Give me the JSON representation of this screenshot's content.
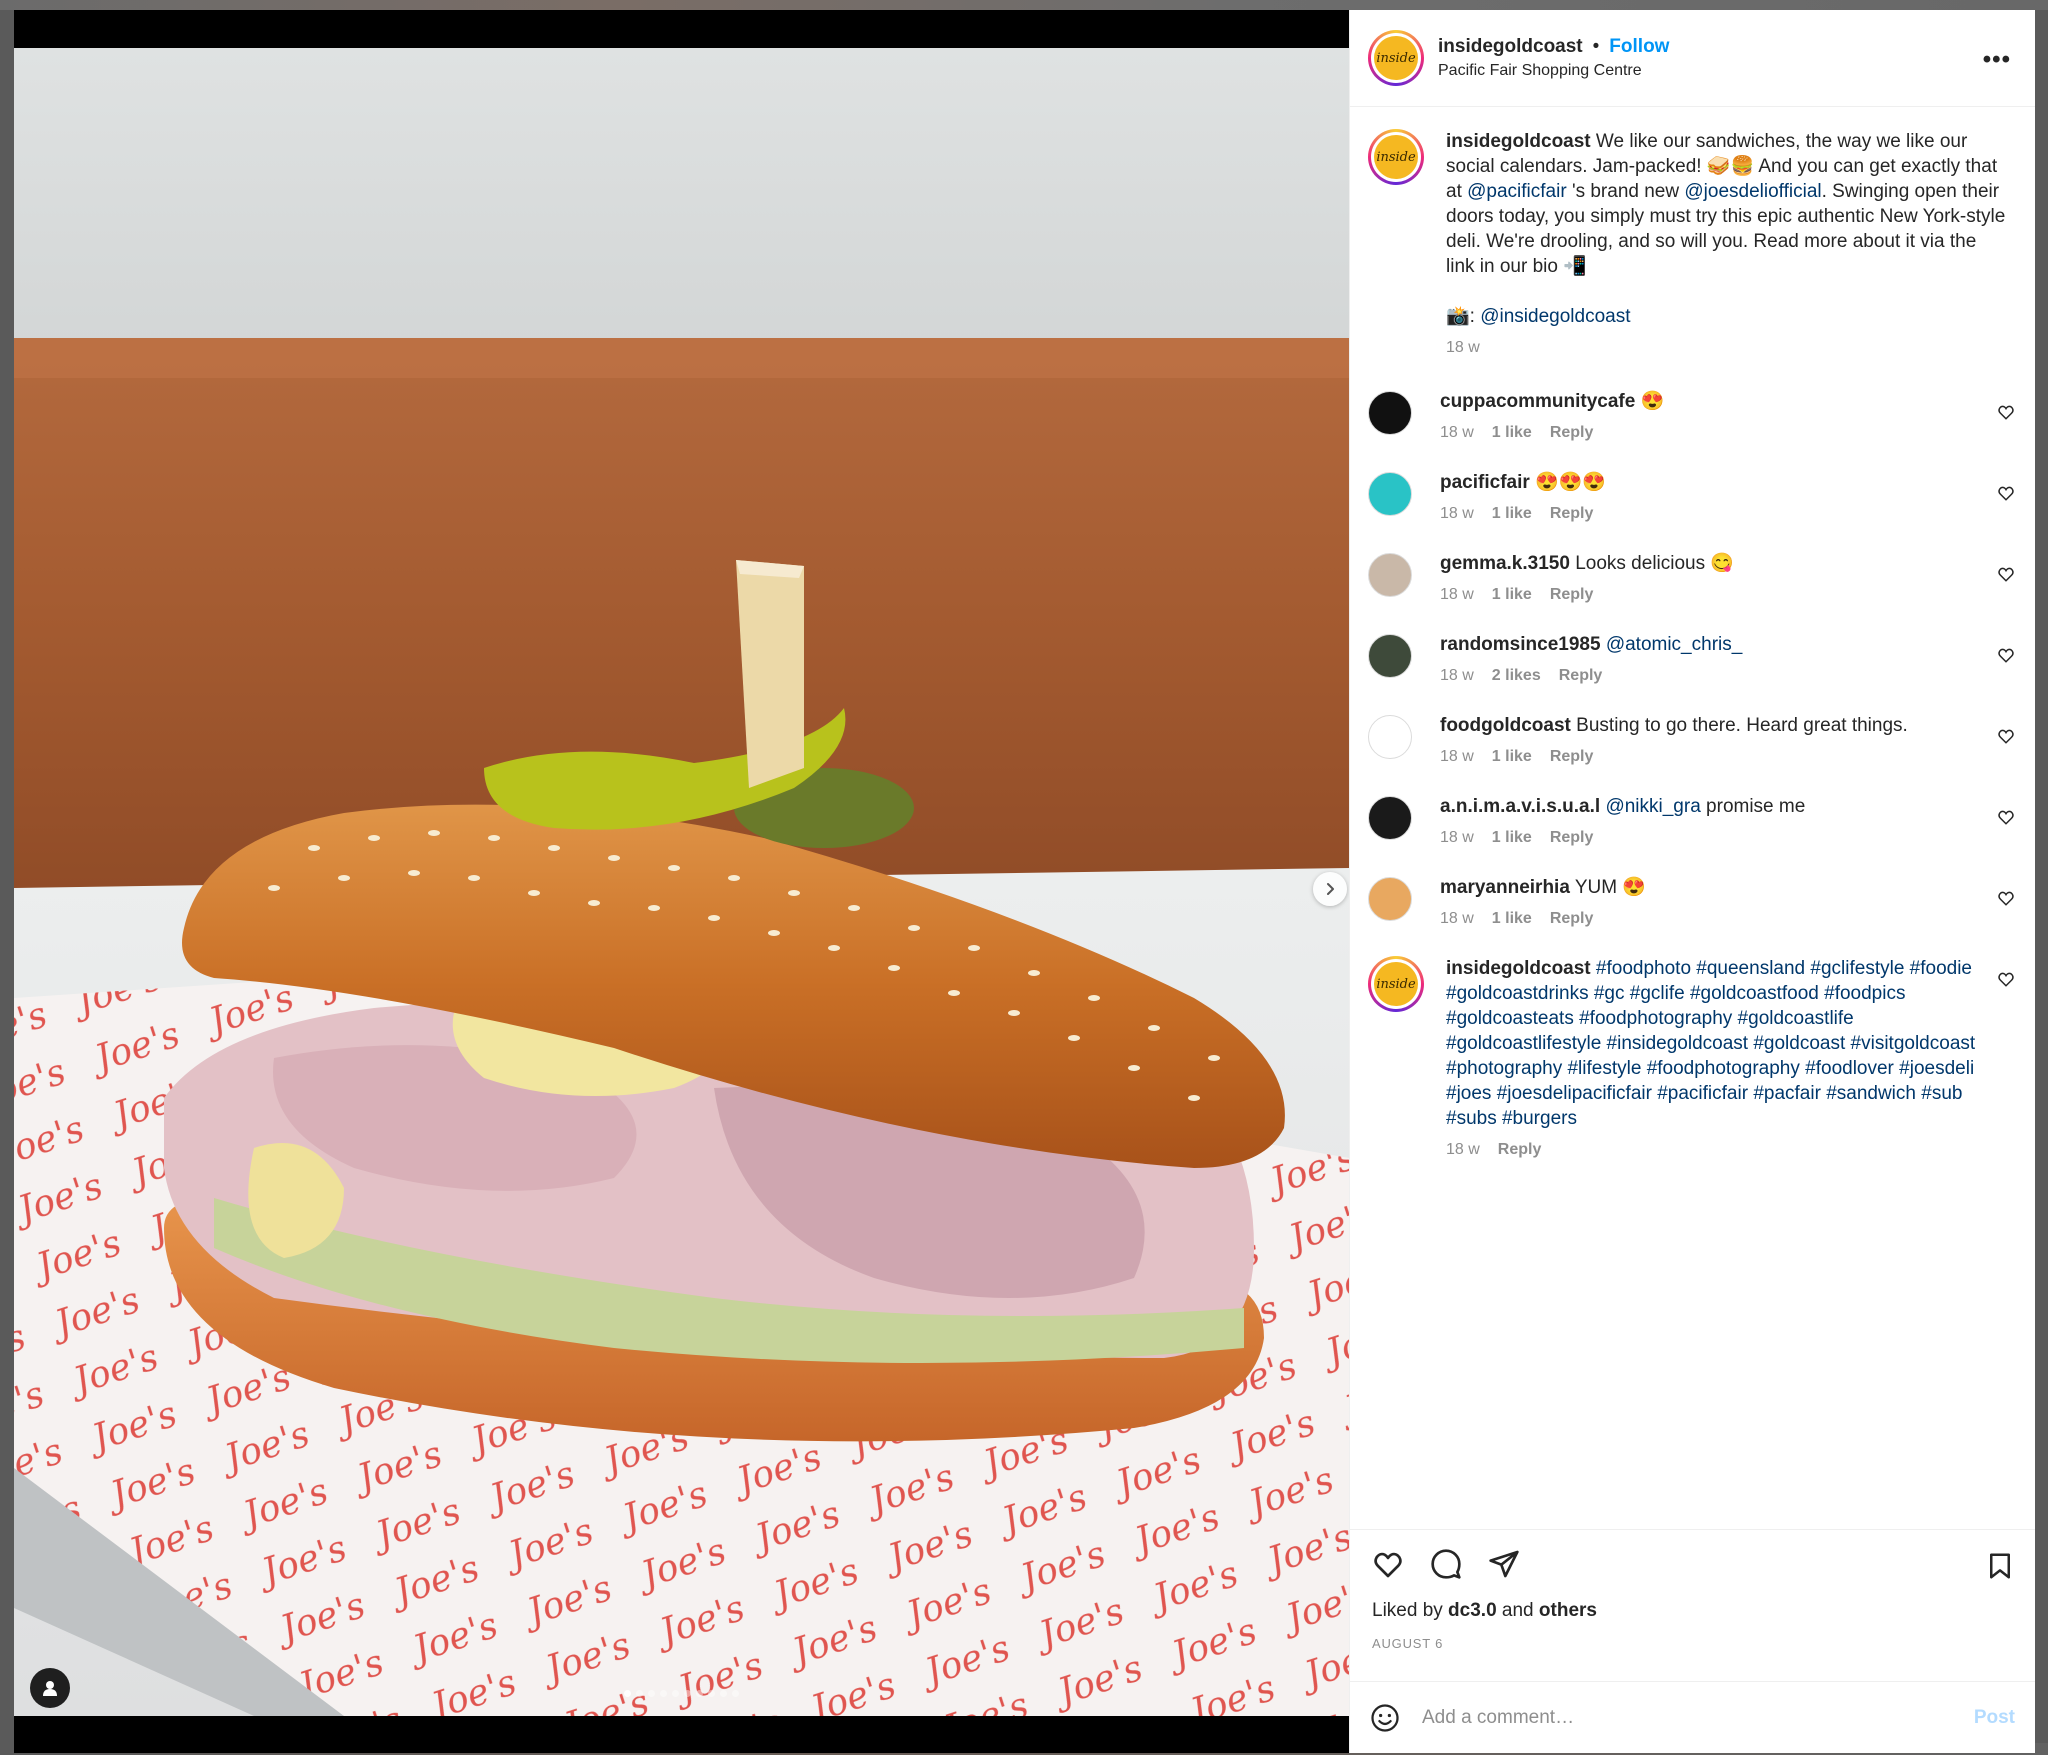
{
  "header": {
    "username": "insidegoldcoast",
    "follow_label": "Follow",
    "location": "Pacific Fair Shopping Centre",
    "more_label": "•••",
    "avatar_text": "inside"
  },
  "caption": {
    "username": "insidegoldcoast",
    "text_1": " We like our sandwiches, the way we like our social calendars. Jam-packed! 🥪🍔 And you can get exactly that at ",
    "mention_1": "@pacificfair",
    "text_2": " 's brand new ",
    "mention_2": "@joesdeliofficial",
    "text_3": ". Swinging open their doors today, you simply must try this epic authentic New York-style deli. We're drooling, and so will you. Read more about it via the link in our bio 📲",
    "credit_prefix": "📸: ",
    "credit_mention": "@insidegoldcoast",
    "time": "18 w"
  },
  "comments": [
    {
      "username": "cuppacommunitycafe",
      "text": " 😍",
      "mention": "",
      "text_after": "",
      "time": "18 w",
      "likes": "1 like",
      "reply": "Reply",
      "avatar_color": "#111111",
      "avatar_icon": "cup-logo-icon"
    },
    {
      "username": "pacificfair",
      "text": " 😍😍😍",
      "mention": "",
      "text_after": "",
      "time": "18 w",
      "likes": "1 like",
      "reply": "Reply",
      "avatar_color": "#29c3c6",
      "avatar_icon": "pacificfair-logo-icon"
    },
    {
      "username": "gemma.k.3150",
      "text": " Looks delicious 😋",
      "mention": "",
      "text_after": "",
      "time": "18 w",
      "likes": "1 like",
      "reply": "Reply",
      "avatar_color": "#c9b8a8",
      "avatar_icon": "profile-photo-icon"
    },
    {
      "username": "randomsince1985",
      "text": " ",
      "mention": "@atomic_chris_",
      "text_after": "",
      "time": "18 w",
      "likes": "2 likes",
      "reply": "Reply",
      "avatar_color": "#3e4a3a",
      "avatar_icon": "profile-photo-icon"
    },
    {
      "username": "foodgoldcoast",
      "text": " Busting to go there. Heard great things.",
      "mention": "",
      "text_after": "",
      "time": "18 w",
      "likes": "1 like",
      "reply": "Reply",
      "avatar_color": "#ffffff",
      "avatar_icon": "foodgoldcoast-logo-icon"
    },
    {
      "username": "a.n.i.m.a.v.i.s.u.a.l",
      "text": " ",
      "mention": "@nikki_gra",
      "text_after": " promise me",
      "time": "18 w",
      "likes": "1 like",
      "reply": "Reply",
      "avatar_color": "#1a1a1a",
      "avatar_icon": "anima-logo-icon"
    },
    {
      "username": "maryanneirhia",
      "text": " YUM 😍",
      "mention": "",
      "text_after": "",
      "time": "18 w",
      "likes": "1 like",
      "reply": "Reply",
      "avatar_color": "#e8a860",
      "avatar_icon": "profile-photo-icon"
    }
  ],
  "hashtags_comment": {
    "username": "insidegoldcoast",
    "tags": "#foodphoto #queensland #gclifestyle #foodie #goldcoastdrinks #gc #gclife #goldcoastfood #foodpics #goldcoasteats #foodphotography #goldcoastlife #goldcoastlifestyle #insidegoldcoast #goldcoast #visitgoldcoast #photography #lifestyle #foodphotography #foodlover #joesdeli #joes #joesdelipacificfair #pacificfair #pacfair #sandwich #sub #subs #burgers",
    "time": "18 w",
    "reply": "Reply"
  },
  "likes": {
    "prefix": "Liked by ",
    "user": "dc3.0",
    "middle": " and ",
    "others": "others"
  },
  "date": "AUGUST 6",
  "add_comment": {
    "placeholder": "Add a comment…",
    "post_label": "Post"
  },
  "carousel": {
    "count": 10,
    "active": 0
  },
  "colors": {
    "accent": "#0095f6",
    "mention": "#00376b",
    "muted": "#8e8e8e",
    "post_disabled": "#b3dbff"
  }
}
